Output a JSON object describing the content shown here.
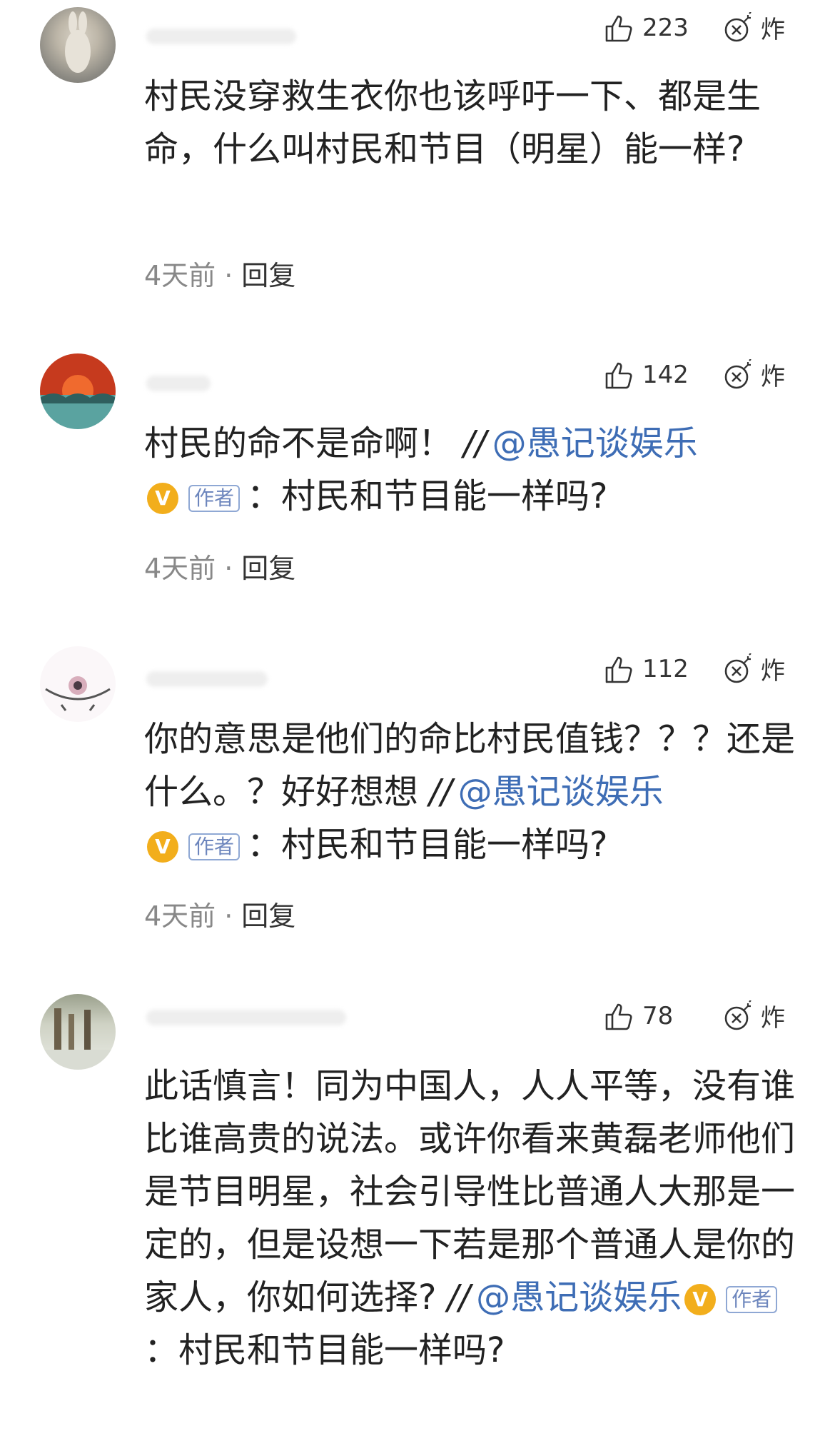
{
  "comments": [
    {
      "likes": "223",
      "bomb_label": "炸",
      "text": "村民没穿救生衣你也该呼吁一下、都是生命，什么叫村民和节目（明星）能一样?",
      "time": "4天前",
      "dot": "·",
      "reply": "回复"
    },
    {
      "likes": "142",
      "bomb_label": "炸",
      "text": "村民的命不是命啊！",
      "slash": "//",
      "mention": "@愚记谈娱乐",
      "badge": "V",
      "author_tag": "作者",
      "quote": "：村民和节目能一样吗?",
      "time": "4天前",
      "dot": "·",
      "reply": "回复"
    },
    {
      "likes": "112",
      "bomb_label": "炸",
      "text": "你的意思是他们的命比村民值钱？？？还是什么。？好好想想",
      "slash": "//",
      "mention": "@愚记谈娱乐",
      "badge": "V",
      "author_tag": "作者",
      "quote": "：村民和节目能一样吗?",
      "time": "4天前",
      "dot": "·",
      "reply": "回复"
    },
    {
      "likes": "78",
      "bomb_label": "炸",
      "text": "此话慎言！同为中国人，人人平等，没有谁比谁高贵的说法。或许你看来黄磊老师他们是节目明星，社会引导性比普通人大那是一定的，但是设想一下若是那个普通人是你的家人，你如何选择?",
      "slash": "//",
      "mention": "@愚记谈娱乐",
      "badge": "V",
      "author_tag": "作者",
      "quote": "：村民和节目能一样吗?"
    }
  ]
}
